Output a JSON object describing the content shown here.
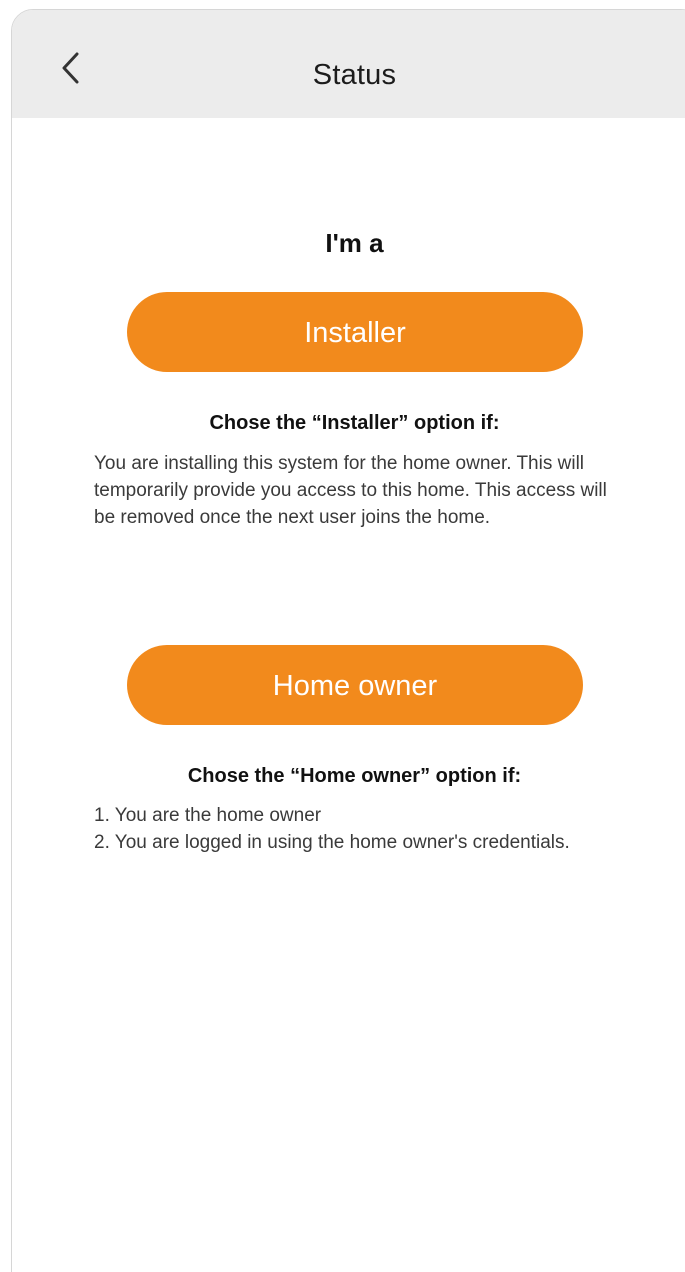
{
  "header": {
    "title": "Status",
    "back_icon": "chevron-left-icon"
  },
  "main": {
    "prompt": "I'm a",
    "installer": {
      "button_label": "Installer",
      "heading": "Chose the “Installer” option if:",
      "description": "You are installing this system for the home owner. This will temporarily provide you access to this home. This access will be removed once the next user joins the home."
    },
    "home_owner": {
      "button_label": "Home owner",
      "heading": "Chose the “Home owner” option if:",
      "reasons": [
        "1. You are the home owner",
        "2. You are logged in using the home owner's credentials."
      ]
    }
  },
  "colors": {
    "accent": "#f28a1c",
    "nav_background": "#ececec"
  }
}
